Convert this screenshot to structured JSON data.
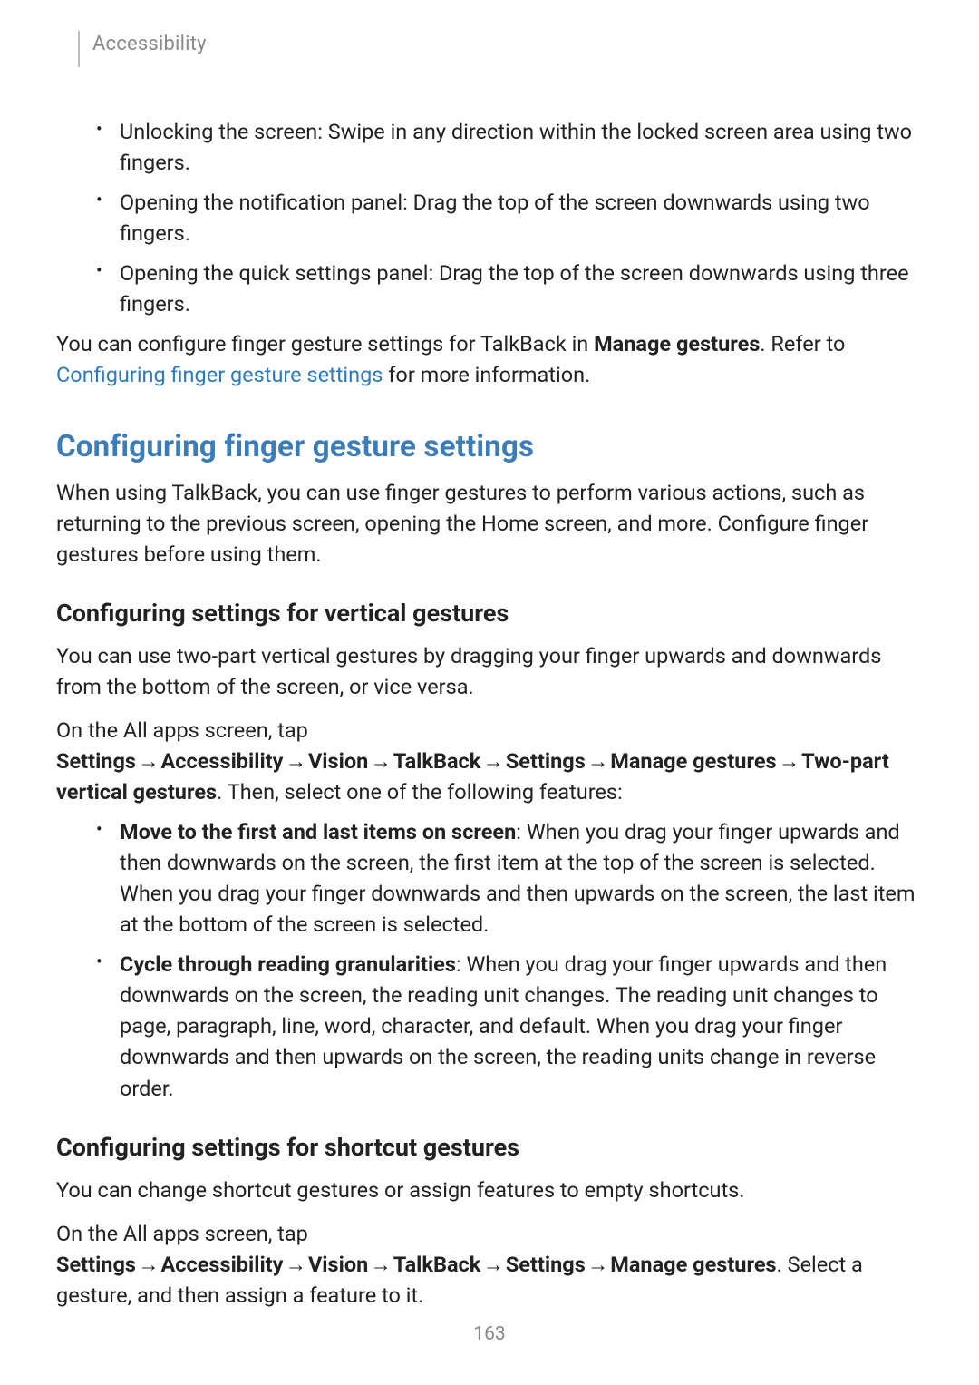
{
  "header": {
    "section": "Accessibility"
  },
  "intro_list": [
    "Unlocking the screen: Swipe in any direction within the locked screen area using two fingers.",
    "Opening the notification panel: Drag the top of the screen downwards using two fingers.",
    "Opening the quick settings panel: Drag the top of the screen downwards using three fingers."
  ],
  "intro_para": {
    "pre": "You can configure finger gesture settings for TalkBack in ",
    "bold": "Manage gestures",
    "mid": ". Refer to ",
    "link": "Configuring finger gesture settings",
    "post": " for more information."
  },
  "section_title": "Configuring finger gesture settings",
  "section_intro": "When using TalkBack, you can use finger gestures to perform various actions, such as returning to the previous screen, opening the Home screen, and more. Configure finger gestures before using them.",
  "vertical": {
    "heading": "Configuring settings for vertical gestures",
    "para": "You can use two-part vertical gestures by dragging your finger upwards and downwards from the bottom of the screen, or vice versa.",
    "path_intro": "On the All apps screen, tap ",
    "path": [
      "Settings",
      "Accessibility",
      "Vision",
      "TalkBack",
      "Settings",
      "Manage gestures",
      "Two-part vertical gestures"
    ],
    "path_outro": ". Then, select one of the following features:",
    "items": [
      {
        "bold": "Move to the first and last items on screen",
        "text": ": When you drag your finger upwards and then downwards on the screen, the first item at the top of the screen is selected. When you drag your finger downwards and then upwards on the screen, the last item at the bottom of the screen is selected."
      },
      {
        "bold": "Cycle through reading granularities",
        "text": ": When you drag your finger upwards and then downwards on the screen, the reading unit changes. The reading unit changes to page, paragraph, line, word, character, and default. When you drag your finger downwards and then upwards on the screen, the reading units change in reverse order."
      }
    ]
  },
  "shortcut": {
    "heading": "Configuring settings for shortcut gestures",
    "para": "You can change shortcut gestures or assign features to empty shortcuts.",
    "path_intro": "On the All apps screen, tap ",
    "path": [
      "Settings",
      "Accessibility",
      "Vision",
      "TalkBack",
      "Settings",
      "Manage gestures"
    ],
    "path_outro": ". Select a gesture, and then assign a feature to it."
  },
  "arrow": "→",
  "page_number": "163"
}
